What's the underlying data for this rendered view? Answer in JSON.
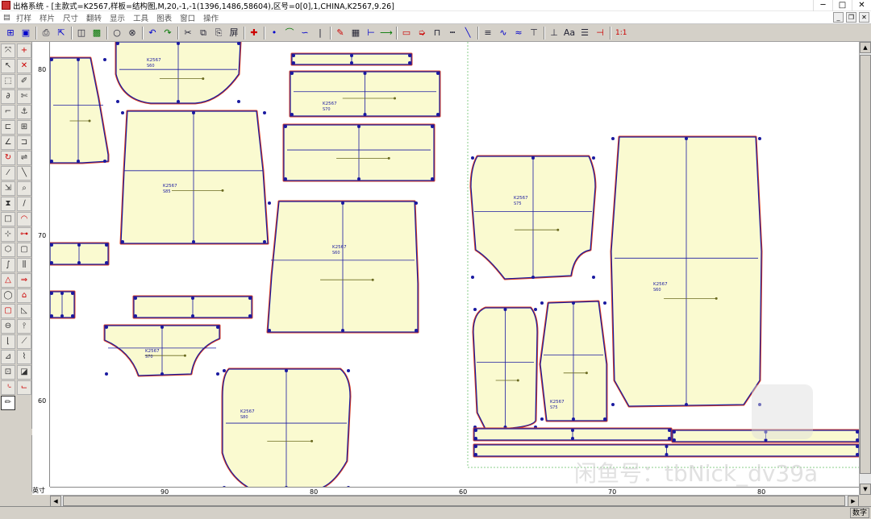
{
  "title": "出格系统 - [主款式=K2567,样板=结构图,M,20,-1,-1(1396,1486,58604),区号=0[0],1,CHINA,K2567,9.26]",
  "menu": [
    "打样",
    "样片",
    "尺寸",
    "翻转",
    "显示",
    "工具",
    "图表",
    "窗口",
    "操作"
  ],
  "toolbar": {
    "buttons": [
      {
        "icon": "file-open-icon",
        "glyph": "⊞",
        "color": "blu"
      },
      {
        "icon": "file-save-icon",
        "glyph": "▣",
        "color": "blu"
      },
      {
        "icon": "print-preview-icon",
        "glyph": "⎙",
        "color": ""
      },
      {
        "icon": "export-icon",
        "glyph": "⇱",
        "color": "blu"
      },
      {
        "icon": "select-all-icon",
        "glyph": "◫",
        "color": ""
      },
      {
        "icon": "record-icon",
        "glyph": "▩",
        "color": "grn"
      },
      {
        "icon": "circle-icon",
        "glyph": "○",
        "color": ""
      },
      {
        "icon": "circles-icon",
        "glyph": "⊗",
        "color": ""
      },
      {
        "icon": "undo-icon",
        "glyph": "↶",
        "color": "blu"
      },
      {
        "icon": "redo-icon",
        "glyph": "↷",
        "color": "grn"
      },
      {
        "icon": "cut-icon",
        "glyph": "✂",
        "color": ""
      },
      {
        "icon": "copy-icon",
        "glyph": "⧉",
        "color": ""
      },
      {
        "icon": "paste-icon",
        "glyph": "⎘",
        "color": ""
      },
      {
        "icon": "grid-toggle-icon",
        "glyph": "屏",
        "color": ""
      },
      {
        "icon": "crosshair-icon",
        "glyph": "✚",
        "color": "red"
      },
      {
        "icon": "point-icon",
        "glyph": "•",
        "color": "blu"
      },
      {
        "icon": "curve-up-icon",
        "glyph": "⌒",
        "color": "grn"
      },
      {
        "icon": "curve-down-icon",
        "glyph": "∽",
        "color": "blu"
      },
      {
        "icon": "sep-line-icon",
        "glyph": "|",
        "color": ""
      },
      {
        "icon": "pen-tool-icon",
        "glyph": "✎",
        "color": "red"
      },
      {
        "icon": "grid-icon",
        "glyph": "▦",
        "color": ""
      },
      {
        "icon": "ruler-icon",
        "glyph": "⊢",
        "color": "blu"
      },
      {
        "icon": "arrow-line-icon",
        "glyph": "⟶",
        "color": "grn"
      },
      {
        "icon": "rect-tool-icon",
        "glyph": "▭",
        "color": "red"
      },
      {
        "icon": "arrow-tool-icon",
        "glyph": "➭",
        "color": "red"
      },
      {
        "icon": "notch-icon",
        "glyph": "⊓",
        "color": ""
      },
      {
        "icon": "dash-line-icon",
        "glyph": "┅",
        "color": ""
      },
      {
        "icon": "diagonal-icon",
        "glyph": "╲",
        "color": "blu"
      },
      {
        "icon": "equal-icon",
        "glyph": "≡",
        "color": ""
      },
      {
        "icon": "wave-icon",
        "glyph": "∿",
        "color": "blu"
      },
      {
        "icon": "wave2-icon",
        "glyph": "≈",
        "color": "blu"
      },
      {
        "icon": "tee-icon",
        "glyph": "⊤",
        "color": ""
      },
      {
        "icon": "tee2-icon",
        "glyph": "⊥",
        "color": ""
      },
      {
        "icon": "text-tool-icon",
        "glyph": "Aa",
        "color": ""
      },
      {
        "icon": "layer-icon",
        "glyph": "☰",
        "color": ""
      },
      {
        "icon": "measure-icon",
        "glyph": "⊣",
        "color": "red"
      }
    ],
    "scale": "1:1"
  },
  "left_tools": [
    {
      "icon": "move-icon",
      "glyph": "⤧",
      "color": ""
    },
    {
      "icon": "add-point-icon",
      "glyph": "+",
      "color": "red"
    },
    {
      "icon": "select-arrow-icon",
      "glyph": "↖",
      "color": ""
    },
    {
      "icon": "delete-icon",
      "glyph": "✕",
      "color": "red"
    },
    {
      "icon": "marquee-icon",
      "glyph": "⬚",
      "color": ""
    },
    {
      "icon": "brush-icon",
      "glyph": "✐",
      "color": ""
    },
    {
      "icon": "lasso-icon",
      "glyph": "∂",
      "color": ""
    },
    {
      "icon": "scissors-icon",
      "glyph": "✄",
      "color": ""
    },
    {
      "icon": "corner-icon",
      "glyph": "⌐",
      "color": ""
    },
    {
      "icon": "anchor-icon",
      "glyph": "⚓",
      "color": ""
    },
    {
      "icon": "bracket-icon",
      "glyph": "⊏",
      "color": ""
    },
    {
      "icon": "split-icon",
      "glyph": "⊞",
      "color": ""
    },
    {
      "icon": "angle-icon",
      "glyph": "∠",
      "color": ""
    },
    {
      "icon": "fold-icon",
      "glyph": "⊐",
      "color": ""
    },
    {
      "icon": "rotate-icon",
      "glyph": "↻",
      "color": "red"
    },
    {
      "icon": "mirror-icon",
      "glyph": "⇌",
      "color": ""
    },
    {
      "icon": "slash-icon",
      "glyph": "⁄",
      "color": ""
    },
    {
      "icon": "diag-icon",
      "glyph": "╲",
      "color": ""
    },
    {
      "icon": "scale-icon",
      "glyph": "⇲",
      "color": ""
    },
    {
      "icon": "zoom-icon",
      "glyph": "⌕",
      "color": ""
    },
    {
      "icon": "hourglass-icon",
      "glyph": "⧗",
      "color": ""
    },
    {
      "icon": "pen-icon",
      "glyph": "∕",
      "color": ""
    },
    {
      "icon": "square-icon",
      "glyph": "□",
      "color": ""
    },
    {
      "icon": "arc-icon",
      "glyph": "◠",
      "color": "red"
    },
    {
      "icon": "plus-grid-icon",
      "glyph": "⊹",
      "color": ""
    },
    {
      "icon": "link-icon",
      "glyph": "⊶",
      "color": "red"
    },
    {
      "icon": "shape-icon",
      "glyph": "⬡",
      "color": ""
    },
    {
      "icon": "frame-icon",
      "glyph": "▢",
      "color": ""
    },
    {
      "icon": "curve-tool-icon",
      "glyph": "∫",
      "color": ""
    },
    {
      "icon": "comb-icon",
      "glyph": "⫼",
      "color": ""
    },
    {
      "icon": "triangle-icon",
      "glyph": "△",
      "color": "red"
    },
    {
      "icon": "arrow-right-icon",
      "glyph": "⇒",
      "color": "red"
    },
    {
      "icon": "circle-tool-icon",
      "glyph": "◯",
      "color": ""
    },
    {
      "icon": "tag-icon",
      "glyph": "⌂",
      "color": "red"
    },
    {
      "icon": "rounded-rect-icon",
      "glyph": "▢",
      "color": "red"
    },
    {
      "icon": "triangle2-icon",
      "glyph": "◺",
      "color": ""
    },
    {
      "icon": "symmetric-icon",
      "glyph": "⊖",
      "color": ""
    },
    {
      "icon": "pin-icon",
      "glyph": "⫯",
      "color": ""
    },
    {
      "icon": "edge-icon",
      "glyph": "⌊",
      "color": ""
    },
    {
      "icon": "knife-icon",
      "glyph": "⟋",
      "color": ""
    },
    {
      "icon": "ruler2-icon",
      "glyph": "⊿",
      "color": ""
    },
    {
      "icon": "sew-line-icon",
      "glyph": "⌇",
      "color": ""
    },
    {
      "icon": "stamp-icon",
      "glyph": "⊡",
      "color": ""
    },
    {
      "icon": "box-icon",
      "glyph": "◪",
      "color": ""
    },
    {
      "icon": "grade-icon",
      "glyph": "⌎",
      "color": "red"
    },
    {
      "icon": "hook-icon",
      "glyph": "⌙",
      "color": "red"
    },
    {
      "icon": "pencil-icon",
      "glyph": "✏",
      "color": ""
    }
  ],
  "rulers": {
    "vertical": [
      "80",
      "70",
      "60"
    ],
    "horizontal": [
      "90",
      "80",
      "60",
      "70",
      "80"
    ],
    "unit": "英寸"
  },
  "piece_labels": {
    "style": "K2567",
    "codes": [
      "S60",
      "S85",
      "S70",
      "S60",
      "S75",
      "S60",
      "S80",
      "S75",
      "S70"
    ]
  },
  "status": {
    "mode": "数字"
  },
  "watermark": {
    "text": "闲鱼号：tbNick_dv39a"
  }
}
